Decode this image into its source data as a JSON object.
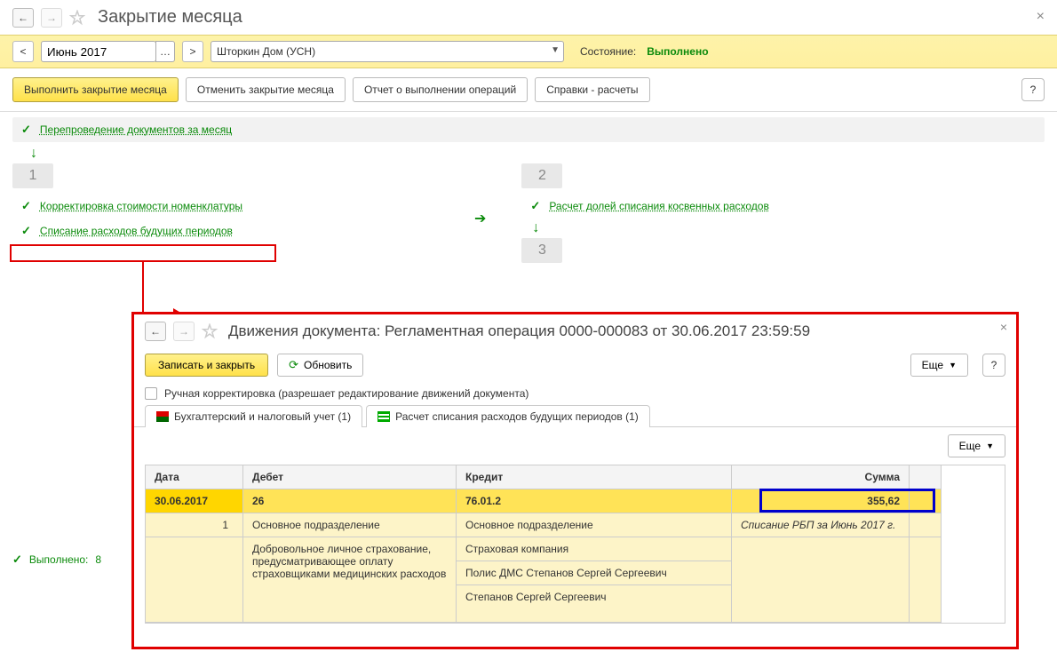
{
  "header": {
    "title": "Закрытие месяца"
  },
  "filter": {
    "period": "Июнь 2017",
    "organization": "Шторкин Дом (УСН)",
    "state_label": "Состояние:",
    "state_value": "Выполнено"
  },
  "toolbar": {
    "execute": "Выполнить закрытие месяца",
    "cancel": "Отменить закрытие месяца",
    "report": "Отчет о выполнении операций",
    "refs": "Справки - расчеты",
    "help": "?"
  },
  "ops": {
    "repost": "Перепроведение документов за месяц",
    "stage1_item1": "Корректировка стоимости номенклатуры",
    "stage1_item2": "Списание расходов будущих периодов",
    "stage2_item1": "Расчет долей списания косвенных расходов",
    "num1": "1",
    "num2": "2",
    "num3": "3"
  },
  "footer": {
    "done_label": "Выполнено:",
    "done_count": "8"
  },
  "modal": {
    "title": "Движения документа: Регламентная операция 0000-000083 от 30.06.2017 23:59:59",
    "save_close": "Записать и закрыть",
    "refresh": "Обновить",
    "more": "Еще",
    "help": "?",
    "manual_label": "Ручная корректировка (разрешает редактирование движений документа)",
    "tab1": "Бухгалтерский и налоговый учет (1)",
    "tab2": "Расчет списания расходов будущих периодов (1)",
    "cols": {
      "date": "Дата",
      "debit": "Дебет",
      "credit": "Кредит",
      "sum": "Сумма"
    },
    "row1": {
      "date": "30.06.2017",
      "debit": "26",
      "credit": "76.01.2",
      "sum": "355,62"
    },
    "row2": {
      "idx": "1",
      "debit": "Основное подразделение",
      "credit": "Основное подразделение",
      "desc": "Списание РБП за Июнь 2017 г."
    },
    "row3": {
      "debit": "Добровольное личное страхование, предусматривающее оплату страховщиками медицинских расходов",
      "credit1": "Страховая компания",
      "credit2": "Полис ДМС Степанов Сергей Сергеевич",
      "credit3": "Степанов Сергей Сергеевич"
    }
  }
}
